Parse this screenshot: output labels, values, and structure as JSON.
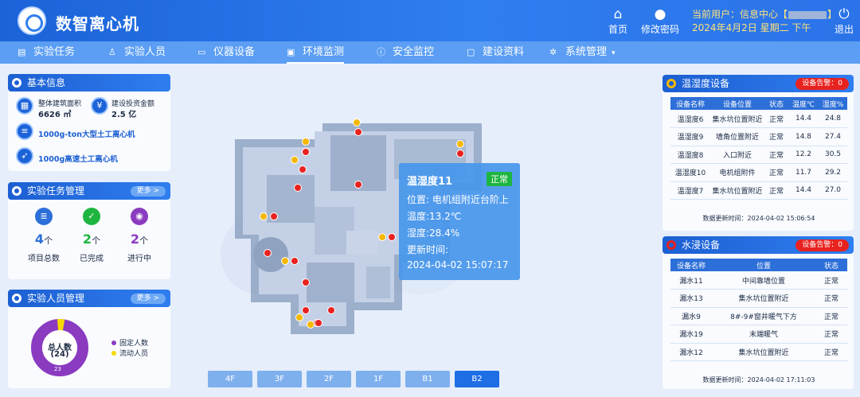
{
  "header": {
    "app_title": "数智离心机",
    "home_label": "首页",
    "change_pwd_label": "修改密码",
    "current_user_prefix": "当前用户：信息中心【",
    "current_user_suffix": "】",
    "datetime": "2024年4月2日 星期二 下午",
    "logout_label": "退出"
  },
  "nav": {
    "items": [
      {
        "label": "实验任务",
        "icon": "task-icon"
      },
      {
        "label": "实验人员",
        "icon": "user-icon"
      },
      {
        "label": "仪器设备",
        "icon": "monitor-icon"
      },
      {
        "label": "环境监测",
        "icon": "env-icon",
        "active": true
      },
      {
        "label": "安全监控",
        "icon": "info-icon"
      },
      {
        "label": "建设资料",
        "icon": "folder-icon"
      },
      {
        "label": "系统管理",
        "icon": "gear-icon"
      }
    ]
  },
  "basic_info": {
    "title": "基本信息",
    "area_label": "整体建筑面积",
    "area_value": "6626 ㎡",
    "invest_label": "建设投资金额",
    "invest_value": "2.5 亿",
    "device1": "1000g-ton大型土工离心机",
    "device2": "1000g高速土工离心机"
  },
  "tasks": {
    "title": "实验任务管理",
    "more": "更多 >",
    "total_value": "4",
    "total_unit": "个",
    "total_label": "项目总数",
    "done_value": "2",
    "done_unit": "个",
    "done_label": "已完成",
    "ongoing_value": "2",
    "ongoing_unit": "个",
    "ongoing_label": "进行中"
  },
  "staff": {
    "title": "实验人员管理",
    "more": "更多 >",
    "donut_center": "总人数",
    "donut_total": "(24)",
    "small_label": "23",
    "legend_fixed": "固定人数",
    "legend_flow": "流动人员",
    "fixed_fraction": 0.958
  },
  "th_devices": {
    "title": "温湿度设备",
    "alarm": "设备告警：0",
    "headers": [
      "设备名称",
      "设备位置",
      "状态",
      "温度℃",
      "湿度%"
    ],
    "rows": [
      [
        "温湿度6",
        "集水坑位置附近",
        "正常",
        "14.4",
        "24.8"
      ],
      [
        "温湿度9",
        "墙角位置附近",
        "正常",
        "14.8",
        "27.4"
      ],
      [
        "温湿度8",
        "入口附近",
        "正常",
        "12.2",
        "30.5"
      ],
      [
        "温湿度10",
        "电机组附件",
        "正常",
        "11.7",
        "29.2"
      ],
      [
        "温湿度7",
        "集水坑位置附近",
        "正常",
        "14.4",
        "27.0"
      ]
    ],
    "update_time": "数据更新时间：2024-04-02 15:06:54"
  },
  "water_devices": {
    "title": "水浸设备",
    "alarm": "设备告警：0",
    "headers": [
      "设备名称",
      "位置",
      "状态"
    ],
    "rows": [
      [
        "漏水11",
        "中间靠墙位置",
        "正常"
      ],
      [
        "漏水13",
        "集水坑位置附近",
        "正常"
      ],
      [
        "漏水9",
        "8#-9#窗井暖气下方",
        "正常"
      ],
      [
        "漏水19",
        "末端暖气",
        "正常"
      ],
      [
        "漏水12",
        "集水坑位置附近",
        "正常"
      ]
    ],
    "update_time": "数据更新时间：2024-04-02 17:11:03"
  },
  "popup": {
    "title": "温湿度11",
    "status": "正常",
    "location": "位置: 电机组附近台阶上",
    "temperature": "温度:13.2℃",
    "humidity": "湿度:28.4%",
    "update_label": "更新时间:",
    "update_time": "2024-04-02 15:07:17"
  },
  "floors": {
    "buttons": [
      "4F",
      "3F",
      "2F",
      "1F",
      "B1",
      "B2"
    ],
    "active": "B2"
  },
  "colors": {
    "accent": "#1c5fd2",
    "nav": "#5b9ef3",
    "alarm": "#e8221f",
    "normal": "#1db53f",
    "marker_yellow": "#f5b800"
  }
}
